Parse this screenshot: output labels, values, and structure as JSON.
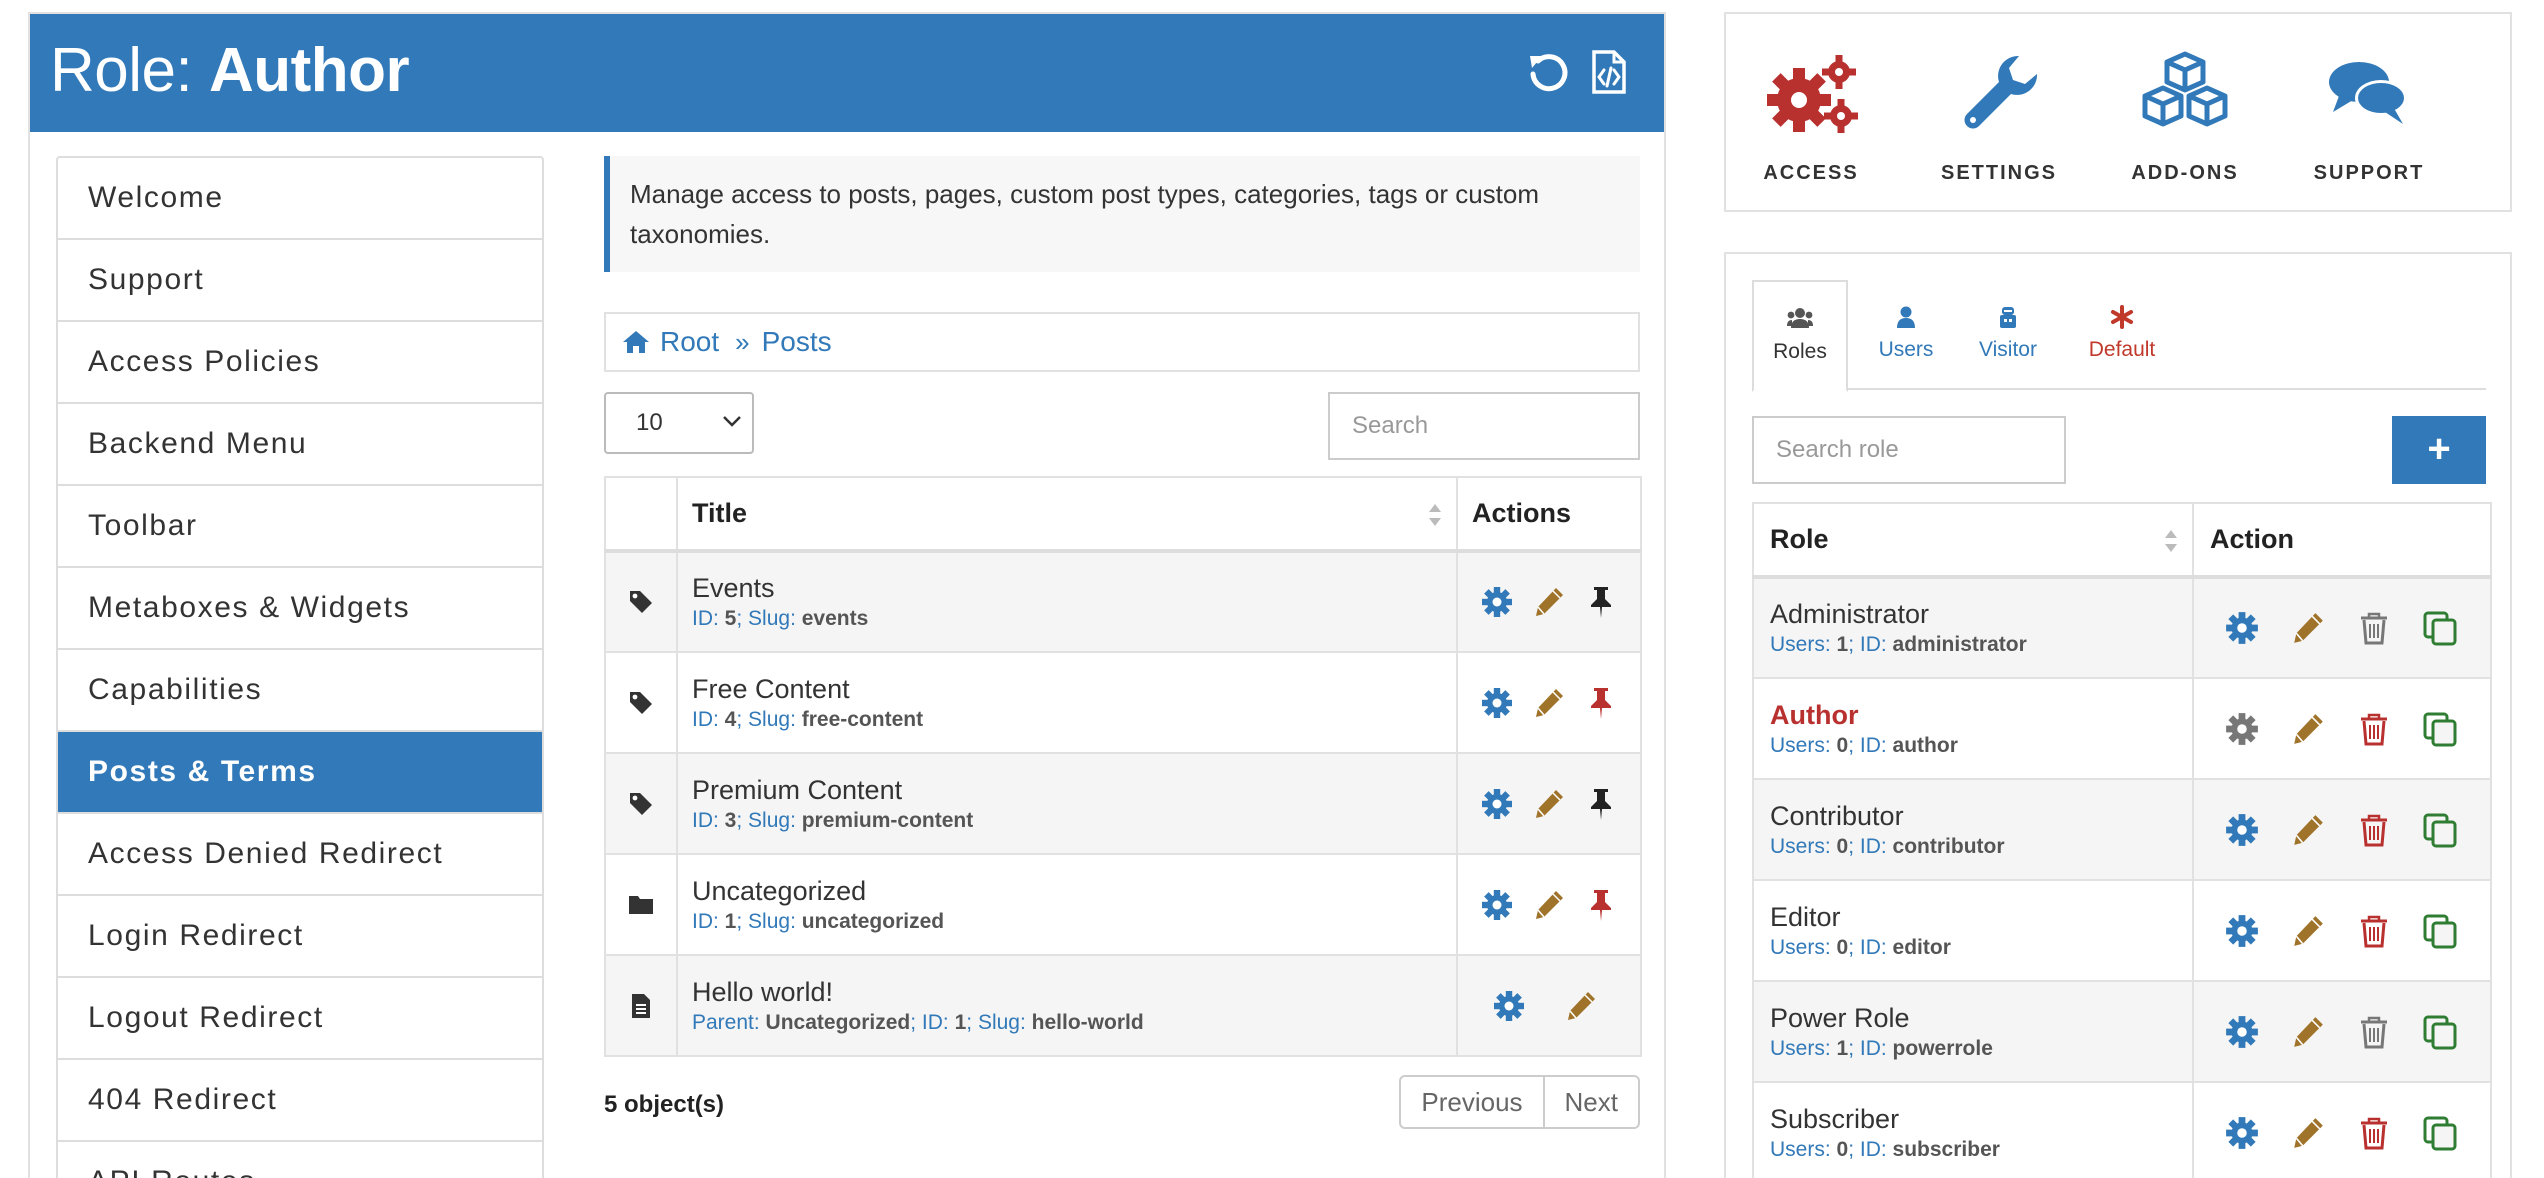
{
  "header": {
    "prefix": "Role: ",
    "role": "Author"
  },
  "side_menu": [
    {
      "label": "Welcome",
      "active": false
    },
    {
      "label": "Support",
      "active": false
    },
    {
      "label": "Access Policies",
      "active": false
    },
    {
      "label": "Backend Menu",
      "active": false
    },
    {
      "label": "Toolbar",
      "active": false
    },
    {
      "label": "Metaboxes & Widgets",
      "active": false
    },
    {
      "label": "Capabilities",
      "active": false
    },
    {
      "label": "Posts & Terms",
      "active": true
    },
    {
      "label": "Access Denied Redirect",
      "active": false
    },
    {
      "label": "Login Redirect",
      "active": false
    },
    {
      "label": "Logout Redirect",
      "active": false
    },
    {
      "label": "404 Redirect",
      "active": false
    },
    {
      "label": "API Routes",
      "active": false
    }
  ],
  "info": "Manage access to posts, pages, custom post types, categories, tags or custom taxonomies.",
  "breadcrumb": {
    "root": "Root",
    "current": "Posts"
  },
  "table_controls": {
    "page_length": "10",
    "search_placeholder": "Search"
  },
  "posts_table": {
    "headers": {
      "title": "Title",
      "actions": "Actions"
    },
    "rows": [
      {
        "icon": "tag-icon",
        "name": "Events",
        "meta": [
          [
            "ID",
            "5"
          ],
          [
            "Slug",
            "events"
          ]
        ],
        "pinned": false
      },
      {
        "icon": "tag-icon",
        "name": "Free Content",
        "meta": [
          [
            "ID",
            "4"
          ],
          [
            "Slug",
            "free-content"
          ]
        ],
        "pinned": true
      },
      {
        "icon": "tag-icon",
        "name": "Premium Content",
        "meta": [
          [
            "ID",
            "3"
          ],
          [
            "Slug",
            "premium-content"
          ]
        ],
        "pinned": false
      },
      {
        "icon": "folder-icon",
        "name": "Uncategorized",
        "meta": [
          [
            "ID",
            "1"
          ],
          [
            "Slug",
            "uncategorized"
          ]
        ],
        "pinned": true
      },
      {
        "icon": "document-icon",
        "name": "Hello world!",
        "meta": [
          [
            "Parent",
            "Uncategorized"
          ],
          [
            "ID",
            "1"
          ],
          [
            "Slug",
            "hello-world"
          ]
        ],
        "pinned": null
      }
    ],
    "count": "5 object(s)",
    "pager": {
      "previous": "Previous",
      "next": "Next"
    }
  },
  "top_nav": [
    {
      "label": "ACCESS",
      "icon": "gears-icon",
      "color": "#b8312f"
    },
    {
      "label": "SETTINGS",
      "icon": "wrench-icon",
      "color": "#3179b8"
    },
    {
      "label": "ADD-ONS",
      "icon": "cubes-icon",
      "color": "#3179b8"
    },
    {
      "label": "SUPPORT",
      "icon": "comments-icon",
      "color": "#3179b8"
    }
  ],
  "role_tabs": [
    {
      "label": "Roles",
      "icon": "users-group-icon",
      "active": true
    },
    {
      "label": "Users",
      "icon": "user-icon",
      "active": false
    },
    {
      "label": "Visitor",
      "icon": "visitor-icon",
      "active": false
    },
    {
      "label": "Default",
      "icon": "asterisk-icon",
      "active": false
    }
  ],
  "role_search_placeholder": "Search role",
  "add_button": "+",
  "roles_table": {
    "headers": {
      "role": "Role",
      "action": "Action"
    },
    "rows": [
      {
        "name": "Administrator",
        "users": "1",
        "id": "administrator",
        "current": false,
        "deletable": false
      },
      {
        "name": "Author",
        "users": "0",
        "id": "author",
        "current": true,
        "deletable": true
      },
      {
        "name": "Contributor",
        "users": "0",
        "id": "contributor",
        "current": false,
        "deletable": true
      },
      {
        "name": "Editor",
        "users": "0",
        "id": "editor",
        "current": false,
        "deletable": true
      },
      {
        "name": "Power Role",
        "users": "1",
        "id": "powerrole",
        "current": false,
        "deletable": false
      },
      {
        "name": "Subscriber",
        "users": "0",
        "id": "subscriber",
        "current": false,
        "deletable": true
      }
    ]
  },
  "colors": {
    "primary": "#3179b8",
    "danger": "#b8312f",
    "edit": "#a0732b",
    "copy": "#2e7d32",
    "muted": "#777777"
  }
}
